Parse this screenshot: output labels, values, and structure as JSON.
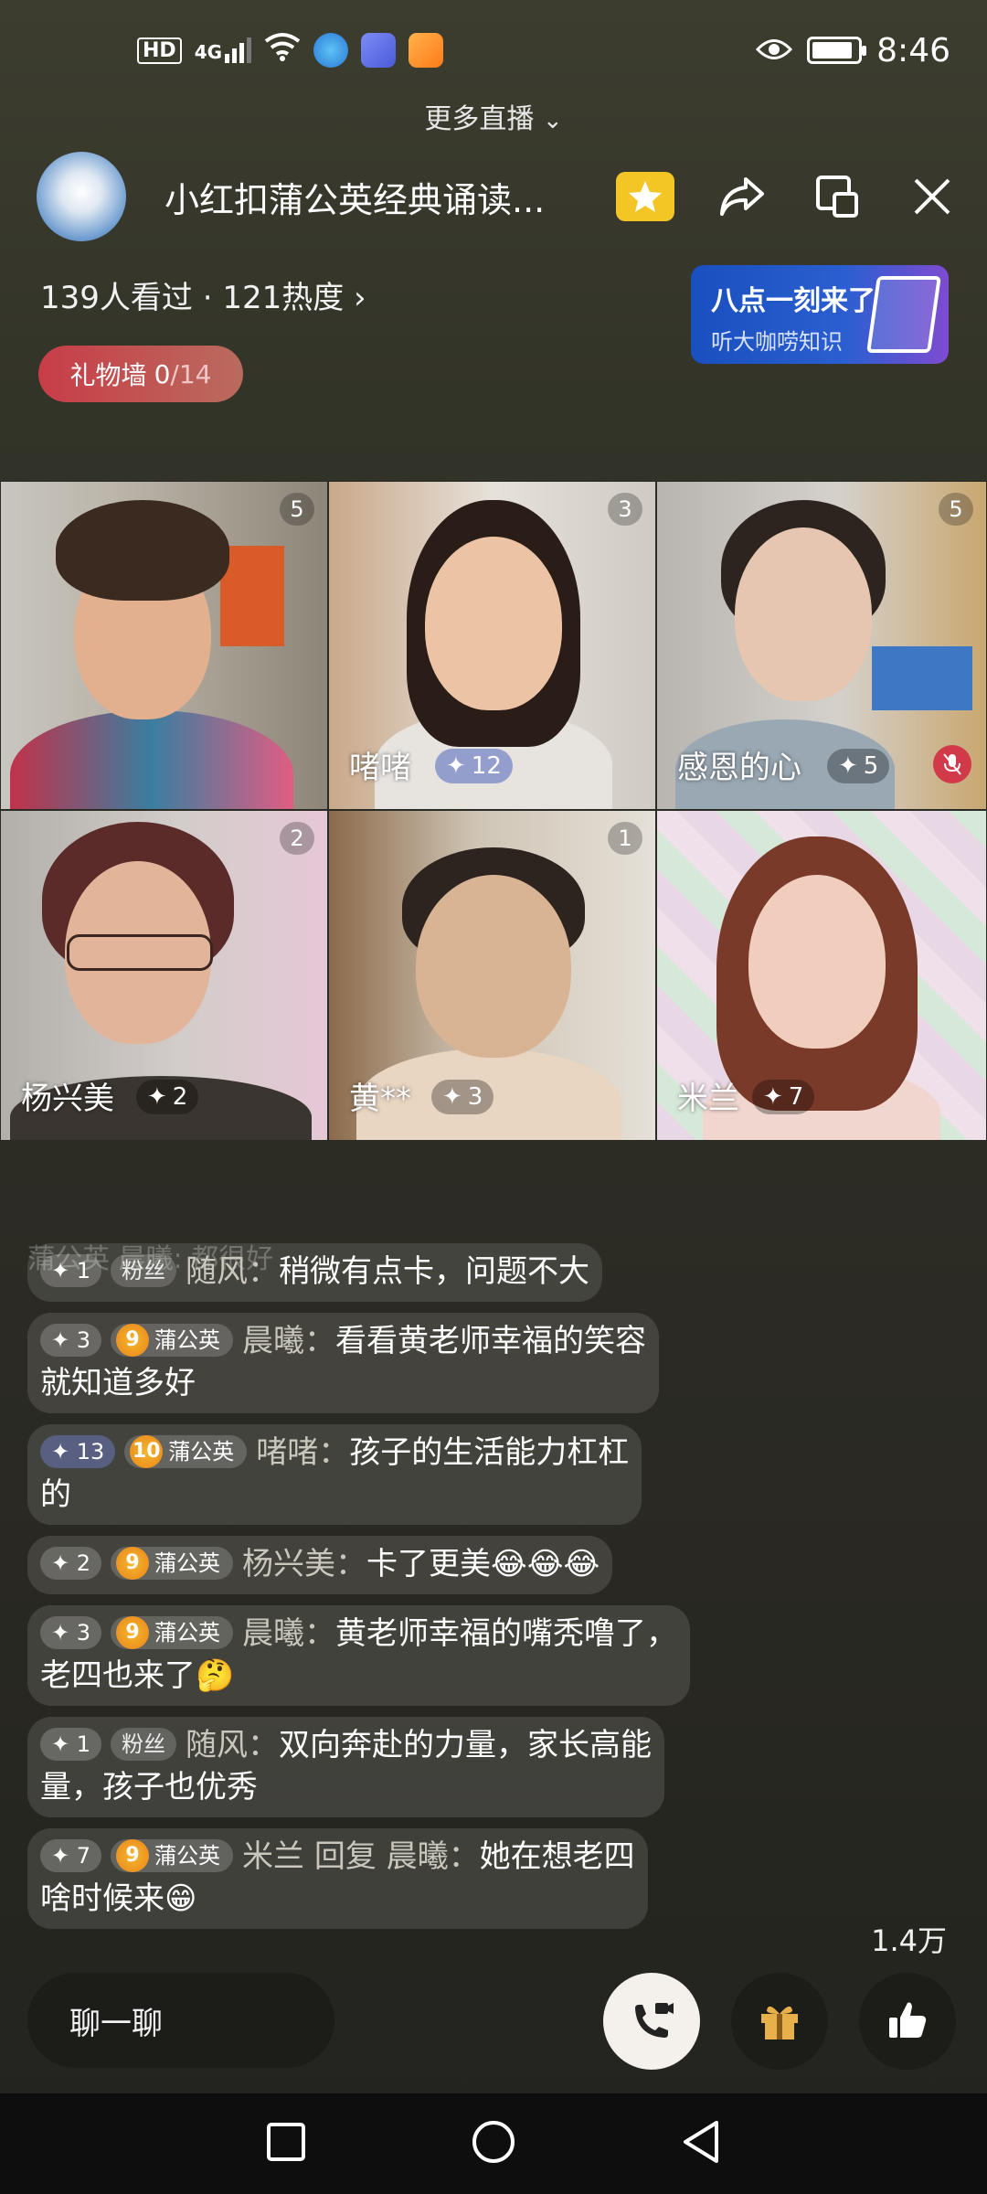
{
  "status_bar": {
    "hd": "HD",
    "signal": "4G",
    "time": "8:46"
  },
  "top": {
    "more_live": "更多直播",
    "room_title": "小红扣蒲公英经典诵读...",
    "stats": "139人看过 · 121热度",
    "gift_wall": {
      "label": "礼物墙",
      "current": "0",
      "total": "/14"
    },
    "banner": {
      "line1": "八点一刻来了",
      "line2": "听大咖唠知识"
    }
  },
  "participants": [
    {
      "seat": "5",
      "name": "",
      "badge": ""
    },
    {
      "seat": "3",
      "name": "啫啫",
      "badge": "12"
    },
    {
      "seat": "5",
      "name": "感恩的心",
      "badge": "5"
    },
    {
      "seat": "2",
      "name": "杨兴美",
      "badge": "2"
    },
    {
      "seat": "1",
      "name": "黄**",
      "badge": "3"
    },
    {
      "seat": "",
      "name": "米兰",
      "badge": "7"
    }
  ],
  "chat": {
    "faded": "蒲公英 晨曦: 都很好",
    "messages": [
      {
        "level": "1",
        "badge": "粉丝",
        "badge_type": "fan",
        "user": "随风",
        "text": "稍微有点卡，问题不大",
        "wrap": ""
      },
      {
        "level": "3",
        "badge": "蒲公英",
        "badge_num": "9",
        "badge_type": "pu",
        "user": "晨曦",
        "text": "看看黄老师幸福的笑容",
        "wrap": "就知道多好"
      },
      {
        "level": "13",
        "badge": "蒲公英",
        "badge_num": "10",
        "badge_type": "pu",
        "user": "啫啫",
        "text": "孩子的生活能力杠杠",
        "wrap": "的"
      },
      {
        "level": "2",
        "badge": "蒲公英",
        "badge_num": "9",
        "badge_type": "pu",
        "user": "杨兴美",
        "text": "卡了更美😂😂😂",
        "wrap": ""
      },
      {
        "level": "3",
        "badge": "蒲公英",
        "badge_num": "9",
        "badge_type": "pu",
        "user": "晨曦",
        "text": "黄老师幸福的嘴秃噜了，",
        "wrap": "老四也来了🤔"
      },
      {
        "level": "1",
        "badge": "粉丝",
        "badge_type": "fan",
        "user": "随风",
        "text": "双向奔赴的力量，家长高能",
        "wrap": "量，孩子也优秀"
      },
      {
        "level": "7",
        "badge": "蒲公英",
        "badge_num": "9",
        "badge_type": "pu",
        "user": "米兰 回复 晨曦",
        "text": "她在想老四",
        "wrap": "啥时候来😁"
      }
    ]
  },
  "bottom": {
    "like_count": "1.4万",
    "chat_placeholder": "聊一聊"
  },
  "colors": {
    "accent_gold": "#f3c625",
    "gift_wall": "#c83d48",
    "banner_blue": "#1a4fbf"
  }
}
